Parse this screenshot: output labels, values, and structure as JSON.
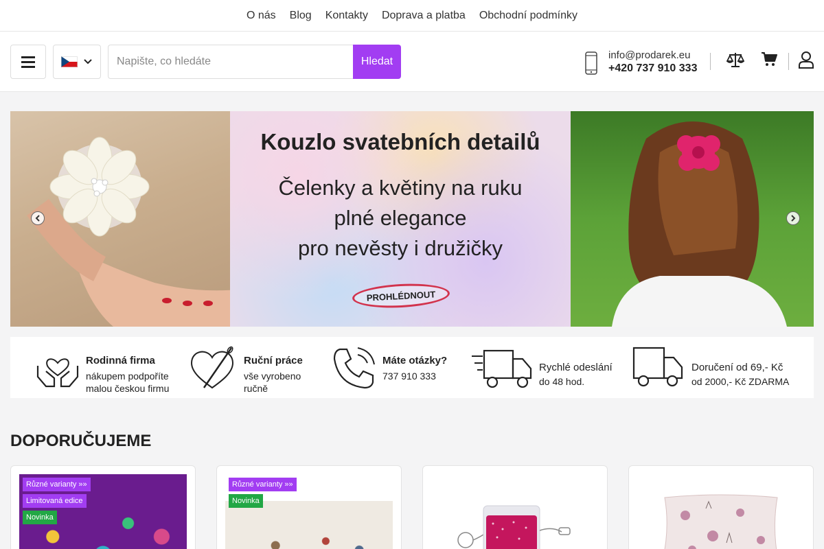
{
  "topnav": {
    "links": [
      "O nás",
      "Blog",
      "Kontakty",
      "Doprava a platba",
      "Obchodní podmínky"
    ]
  },
  "header": {
    "search_placeholder": "Napište, co hledáte",
    "search_button": "Hledat",
    "email": "info@prodarek.eu",
    "phone": "+420 737 910 333",
    "icons": [
      "menu-icon",
      "czech-flag-icon",
      "chevron-down-icon",
      "mobile-phone-icon",
      "compare-scale-icon",
      "cart-icon",
      "user-icon"
    ]
  },
  "banner": {
    "title": "Kouzlo svatebních detailů",
    "lines": [
      "Čelenky a květiny na ruku",
      "plné elegance",
      "pro nevěsty i družičky"
    ],
    "cta": "PROHLÉDNOUT"
  },
  "benefits": [
    {
      "title": "Rodinná firma",
      "text1": "nákupem podpoříte",
      "text2": "malou českou firmu",
      "icon": "hands-heart-icon"
    },
    {
      "title": "Ruční práce",
      "text1": "vše vyrobeno",
      "text2": "ručně",
      "icon": "heart-needle-icon"
    },
    {
      "title": "Máte otázky?",
      "text1": "737 910 333",
      "text2": "",
      "icon": "phone-icon"
    },
    {
      "title": "Rychlé odeslání",
      "text1": "do 48 hod.",
      "text2": "",
      "icon": "fast-truck-icon"
    },
    {
      "title": "Doručení od 69,- Kč",
      "text1": "od 2000,- Kč ZDARMA",
      "text2": "",
      "icon": "truck-icon"
    }
  ],
  "section": {
    "title": "DOPORUČUJEME"
  },
  "products": [
    {
      "badges": [
        {
          "text": "Různé varianty »»",
          "color": "#a23df2"
        },
        {
          "text": "Limitovaná edice",
          "color": "#a23df2"
        },
        {
          "text": "Novinka",
          "color": "#22a745"
        }
      ]
    },
    {
      "badges": [
        {
          "text": "Různé varianty »»",
          "color": "#a23df2"
        },
        {
          "text": "Novinka",
          "color": "#22a745"
        }
      ]
    },
    {
      "badges": []
    },
    {
      "badges": []
    }
  ],
  "colors": {
    "accent": "#a23df2",
    "new_badge": "#22a745"
  }
}
